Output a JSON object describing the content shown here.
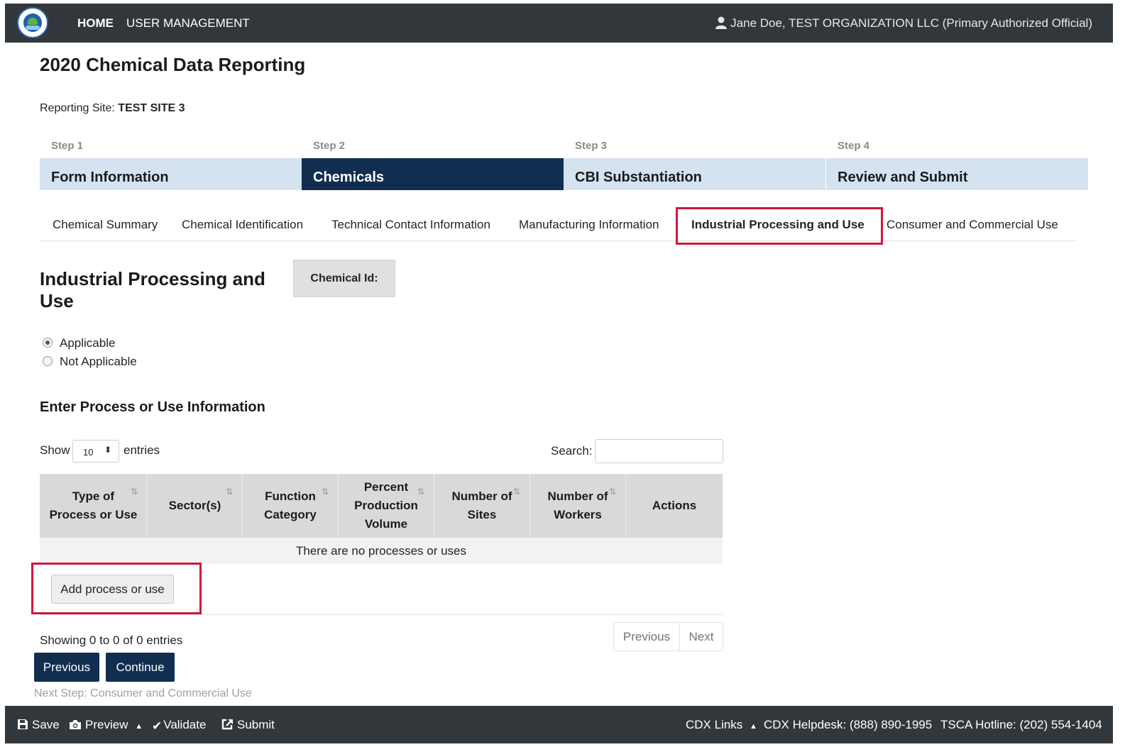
{
  "header": {
    "nav_home": "HOME",
    "nav_user_management": "USER MANAGEMENT",
    "user": "Jane Doe, TEST ORGANIZATION LLC (Primary Authorized Official)"
  },
  "page": {
    "title": "2020 Chemical Data Reporting",
    "site_label": "Reporting Site:",
    "site_value": "TEST SITE 3"
  },
  "steps": [
    {
      "num": "Step 1",
      "name": "Form Information",
      "active": false
    },
    {
      "num": "Step 2",
      "name": "Chemicals",
      "active": true
    },
    {
      "num": "Step 3",
      "name": "CBI Substantiation",
      "active": false
    },
    {
      "num": "Step 4",
      "name": "Review and Submit",
      "active": false
    }
  ],
  "subtabs": [
    "Chemical Summary",
    "Chemical Identification",
    "Technical Contact Information",
    "Manufacturing Information",
    "Industrial Processing and Use",
    "Consumer and Commercial Use"
  ],
  "active_subtab": "Industrial Processing and Use",
  "section": {
    "title": "Industrial Processing and Use",
    "chem_id_label": "Chemical Id:",
    "radio_applicable": "Applicable",
    "radio_not_applicable": "Not Applicable",
    "selected": "Applicable"
  },
  "table": {
    "heading": "Enter Process or Use Information",
    "show": "Show",
    "length_value": "10",
    "entries": "entries",
    "search_label": "Search:",
    "columns": [
      "Type of Process or Use",
      "Sector(s)",
      "Function Category",
      "Percent Production Volume",
      "Number of Sites",
      "Number of Workers",
      "Actions"
    ],
    "empty": "There are no processes or uses",
    "add_button": "Add process or use",
    "info": "Showing 0 to 0 of 0 entries",
    "prev": "Previous",
    "next": "Next"
  },
  "actions": {
    "previous": "Previous",
    "continue": "Continue",
    "next_step": "Next Step: Consumer and Commercial Use"
  },
  "footer": {
    "save": "Save",
    "preview": "Preview",
    "validate": "Validate",
    "submit": "Submit",
    "cdx_links": "CDX Links",
    "helpdesk": "CDX Helpdesk: (888) 890-1995",
    "hotline": "TSCA Hotline: (202) 554-1404"
  },
  "colors": {
    "dark_bar": "#32373c",
    "navy": "#112e51",
    "step_bg": "#d5e3f0",
    "highlight": "#d3163a"
  }
}
